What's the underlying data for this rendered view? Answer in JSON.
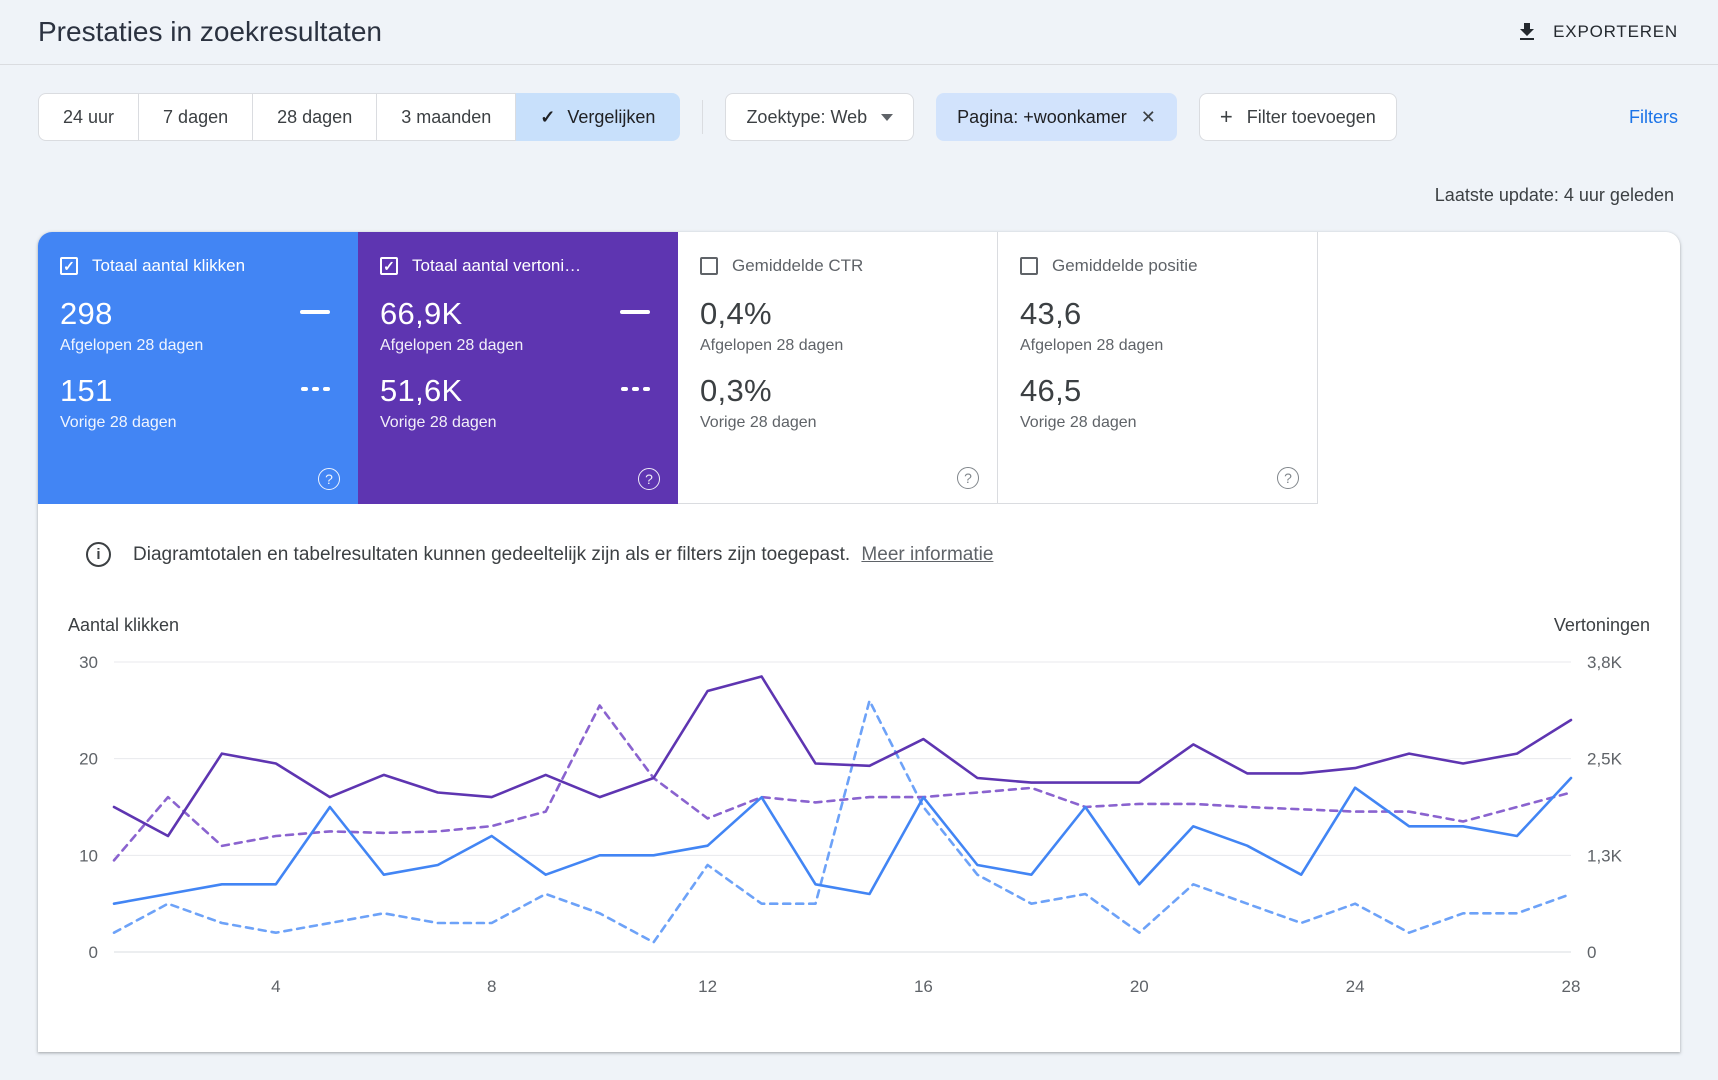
{
  "header": {
    "title": "Prestaties in zoekresultaten",
    "export_label": "EXPORTEREN"
  },
  "filters": {
    "ranges": [
      "24 uur",
      "7 dagen",
      "28 dagen",
      "3 maanden"
    ],
    "compare_label": "Vergelijken",
    "compare_check": "✓",
    "search_type": "Zoektype: Web",
    "page_filter": "Pagina: +woonkamer",
    "page_filter_close": "✕",
    "add_filter": "Filter toevoegen",
    "add_filter_plus": "+",
    "filters_link": "Filters"
  },
  "last_update": "Laatste update: 4 uur geleden",
  "cards": [
    {
      "title": "Totaal aantal klikken",
      "checked": true,
      "color": "#4285f4",
      "value_current": "298",
      "period_current": "Afgelopen 28 dagen",
      "value_previous": "151",
      "period_previous": "Vorige 28 dagen",
      "help": "?"
    },
    {
      "title": "Totaal aantal vertoni…",
      "checked": true,
      "color": "#5e35b1",
      "value_current": "66,9K",
      "period_current": "Afgelopen 28 dagen",
      "value_previous": "51,6K",
      "period_previous": "Vorige 28 dagen",
      "help": "?"
    },
    {
      "title": "Gemiddelde CTR",
      "checked": false,
      "color": "#ffffff",
      "value_current": "0,4%",
      "period_current": "Afgelopen 28 dagen",
      "value_previous": "0,3%",
      "period_previous": "Vorige 28 dagen",
      "help": "?"
    },
    {
      "title": "Gemiddelde positie",
      "checked": false,
      "color": "#ffffff",
      "value_current": "43,6",
      "period_current": "Afgelopen 28 dagen",
      "value_previous": "46,5",
      "period_previous": "Vorige 28 dagen",
      "help": "?"
    }
  ],
  "notice": {
    "text": "Diagramtotalen en tabelresultaten kunnen gedeeltelijk zijn als er filters zijn toegepast.",
    "link": "Meer informatie",
    "icon": "i"
  },
  "chart_data": {
    "type": "line",
    "x_range": [
      1,
      28
    ],
    "x_label_ticks": [
      4,
      8,
      12,
      16,
      20,
      24,
      28
    ],
    "left_axis": {
      "label": "Aantal klikken",
      "min": 0,
      "max": 30,
      "ticks": [
        "0",
        "10",
        "20",
        "30"
      ]
    },
    "right_axis": {
      "label": "Vertoningen",
      "min": 0,
      "max": 3800,
      "ticks": [
        "0",
        "1,3K",
        "2,5K",
        "3,8K"
      ]
    },
    "grid": true,
    "series": [
      {
        "name": "Totaal aantal klikken — afgelopen 28 dagen",
        "axis": "left",
        "style": "solid",
        "color": "#4285f4",
        "values": [
          5,
          6,
          7,
          7,
          15,
          8,
          9,
          12,
          8,
          10,
          10,
          11,
          16,
          7,
          6,
          16,
          9,
          8,
          15,
          7,
          13,
          11,
          8,
          17,
          13,
          13,
          12,
          18
        ]
      },
      {
        "name": "Totaal aantal klikken — vorige 28 dagen",
        "axis": "left",
        "style": "dashed",
        "color": "#6da2f8",
        "values": [
          2,
          5,
          3,
          2,
          3,
          4,
          3,
          3,
          6,
          4,
          1,
          9,
          5,
          5,
          26,
          15,
          8,
          5,
          6,
          2,
          7,
          5,
          3,
          5,
          2,
          4,
          4,
          6
        ]
      },
      {
        "name": "Totaal aantal vertoningen — afgelopen 28 dagen",
        "axis": "right",
        "style": "solid",
        "color": "#5e35b1",
        "values": [
          1900,
          1520,
          2600,
          2470,
          2030,
          2320,
          2090,
          2030,
          2320,
          2030,
          2280,
          3420,
          3610,
          2470,
          2440,
          2790,
          2280,
          2220,
          2220,
          2220,
          2720,
          2340,
          2340,
          2410,
          2600,
          2470,
          2600,
          3040
        ]
      },
      {
        "name": "Totaal aantal vertoningen — vorige 28 dagen",
        "axis": "right",
        "style": "dashed",
        "color": "#8a63cf",
        "values": [
          1200,
          2030,
          1390,
          1520,
          1580,
          1560,
          1580,
          1650,
          1840,
          3230,
          2280,
          1750,
          2030,
          1960,
          2030,
          2030,
          2090,
          2150,
          1900,
          1940,
          1940,
          1900,
          1870,
          1840,
          1840,
          1710,
          1900,
          2090
        ]
      }
    ]
  }
}
